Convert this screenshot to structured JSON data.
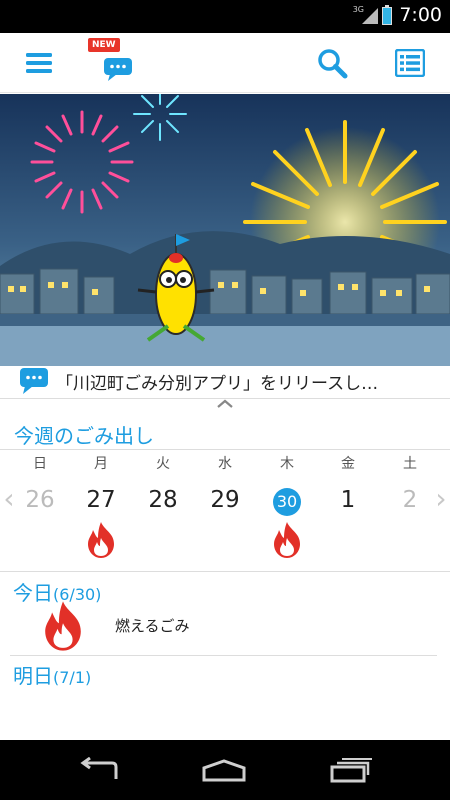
{
  "status_bar": {
    "network": "3G",
    "time": "7:00"
  },
  "toolbar": {
    "news_badge": "NEW",
    "icons": [
      "menu-icon",
      "news-bubble-icon",
      "search-icon",
      "list-icon"
    ]
  },
  "news": {
    "ticker_text": "「川辺町ごみ分別アプリ」をリリースし…"
  },
  "week": {
    "title": "今週のごみ出し",
    "weekdays": [
      "日",
      "月",
      "火",
      "水",
      "木",
      "金",
      "土"
    ],
    "dates": [
      "26",
      "27",
      "28",
      "29",
      "30",
      "1",
      "2"
    ],
    "today_index": 4,
    "burnable_days": [
      1,
      4
    ]
  },
  "today": {
    "label": "今日",
    "date": "(6/30)",
    "items": [
      {
        "name": "燃えるごみ",
        "icon": "fire-icon"
      }
    ]
  },
  "tomorrow": {
    "label": "明日",
    "date": "(7/1)",
    "items": []
  },
  "colors": {
    "accent": "#1e9de0",
    "burnable": "#e23028",
    "toolbar_icon": "#1e9de0"
  }
}
